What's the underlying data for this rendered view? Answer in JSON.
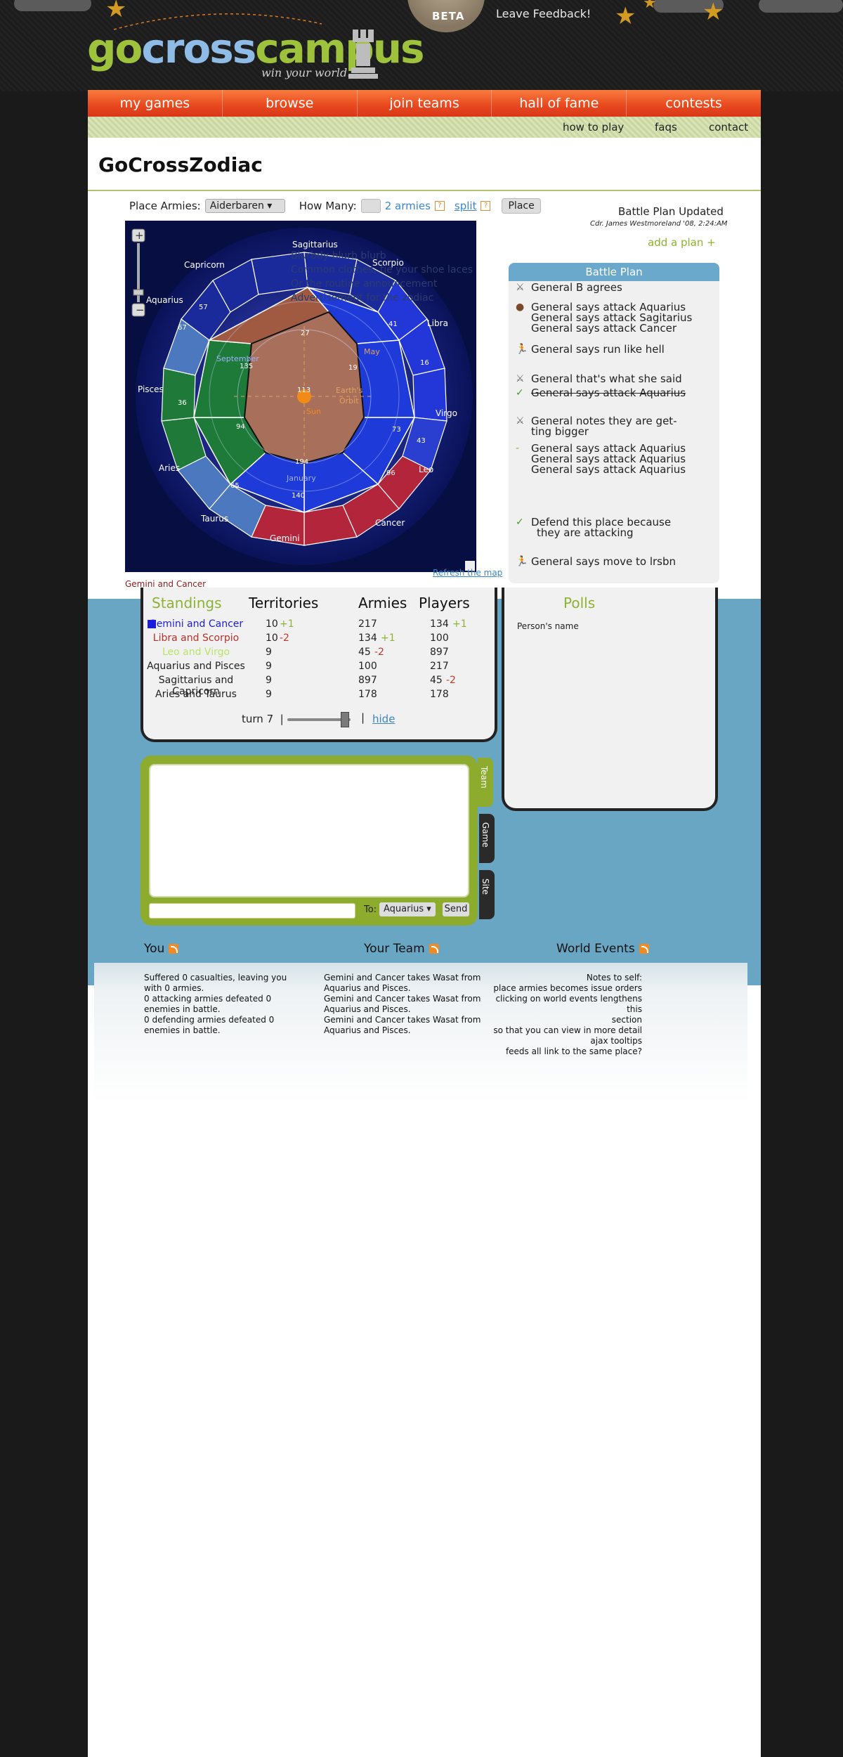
{
  "header": {
    "logo_go": "go",
    "logo_cross": "cross",
    "logo_campus": "campus",
    "tagline": "win your world.",
    "beta": "BETA",
    "feedback": "Leave Feedback!"
  },
  "nav": {
    "items": [
      "my games",
      "browse",
      "join teams",
      "hall of fame",
      "contests"
    ]
  },
  "subnav": {
    "how_to_play": "how to play",
    "faqs": "faqs",
    "contact": "contact"
  },
  "page_title": "GoCrossZodiac",
  "controls": {
    "place_label": "Place Armies:",
    "place_value": "Aiderbaren",
    "how_many_label": "How Many:",
    "armies_link": "2 armies",
    "split_link": "split",
    "place_button": "Place"
  },
  "battle_plan": {
    "updated": "Battle Plan Updated",
    "by": "Cdr. James Westmoreland '08, 2:24:AM",
    "add_plan": "add a plan +",
    "header": "Battle Plan",
    "items": [
      "General B agrees",
      "General says attack Aquarius",
      "General says attack Sagitarius",
      "General says attack Cancer",
      "General says run like hell",
      "General that's what she said",
      "General says attack Aquarius",
      "General notes they are get-",
      "ting bigger",
      "General says attack Aquarius",
      "General says attack Aquarius",
      "General says attack Aquarius",
      "Defend this place because",
      "they are attacking",
      "General says move to lrsbn"
    ]
  },
  "map": {
    "blurb": [
      "Blurbdy blurb blurb",
      "Common clothes, tie your shoe laces",
      "Or the routine announcement",
      "Advertisement for the zodiac"
    ],
    "signs": [
      "Sagittarius",
      "Scorpio",
      "Capricorn",
      "Libra",
      "Aquarius",
      "Virgo",
      "Pisces",
      "Leo",
      "Aries",
      "Cancer",
      "Taurus",
      "Gemini"
    ],
    "inner": [
      "September",
      "May",
      "Earth's",
      "Orbit",
      "Sun",
      "January"
    ],
    "numbers": [
      "27",
      "113",
      "19",
      "194",
      "94",
      "135",
      "140",
      "73",
      "43",
      "96",
      "57",
      "67",
      "65",
      "36",
      "16",
      "41"
    ],
    "refresh": "Refresh the map",
    "hover_label": "Gemini and Cancer"
  },
  "standings": {
    "headers": [
      "Standings",
      "Territories",
      "Armies",
      "Players"
    ],
    "rows": [
      {
        "team": "Gemini and Cancer",
        "color": "#1d1dd8",
        "territories": "10",
        "t_delta": "+1",
        "armies": "217",
        "a_delta": "",
        "players": "134",
        "p_delta": "+1"
      },
      {
        "team": "Libra and Scorpio",
        "color": "#b5322b",
        "territories": "10",
        "t_delta": "-2",
        "armies": "134",
        "a_delta": "+1",
        "players": "100",
        "p_delta": ""
      },
      {
        "team": "Leo and Virgo",
        "color": "#b9e36a",
        "territories": "9",
        "t_delta": "",
        "armies": "45",
        "a_delta": "-2",
        "players": "897",
        "p_delta": ""
      },
      {
        "team": "Aquarius and Pisces",
        "color": "#222222",
        "territories": "9",
        "t_delta": "",
        "armies": "100",
        "a_delta": "",
        "players": "217",
        "p_delta": ""
      },
      {
        "team": "Sagittarius and Capricorn",
        "color": "#222222",
        "territories": "9",
        "t_delta": "",
        "armies": "897",
        "a_delta": "",
        "players": "45",
        "p_delta": "-2"
      },
      {
        "team": "Aries and Taurus",
        "color": "#222222",
        "territories": "9",
        "t_delta": "",
        "armies": "178",
        "a_delta": "",
        "players": "178",
        "p_delta": ""
      }
    ],
    "turn": "turn 7",
    "hide": "hide",
    "turn_slider_value": 0.9
  },
  "polls": {
    "title": "Polls",
    "person": "Person's name"
  },
  "chat": {
    "tabs": [
      "Team",
      "Game",
      "Site"
    ],
    "to_label": "To:",
    "to_value": "Aquarius",
    "send": "Send"
  },
  "feeds": {
    "you": {
      "title": "You",
      "lines": [
        "Suffered 0 casualties, leaving you",
        "with 0 armies.",
        "0 attacking armies defeated 0",
        "enemies in battle.",
        "0 defending armies defeated 0",
        "enemies in battle."
      ]
    },
    "team": {
      "title": "Your Team",
      "lines": [
        "Gemini and Cancer takes Wasat from",
        "Aquarius and Pisces.",
        "Gemini and Cancer takes Wasat from",
        "Aquarius and Pisces.",
        "Gemini and Cancer takes Wasat from",
        "Aquarius and Pisces."
      ]
    },
    "world": {
      "title": "World Events",
      "lines": [
        "Notes to self:",
        "place armies becomes issue orders",
        "clicking on world events lengthens this",
        "section",
        "so that you can view in more detail",
        "ajax tooltips",
        "feeds all link to the same place?"
      ]
    }
  },
  "colors": {
    "accent_green": "#8db330",
    "nav_orange": "#e8471e",
    "band_blue": "#68a6c4"
  }
}
